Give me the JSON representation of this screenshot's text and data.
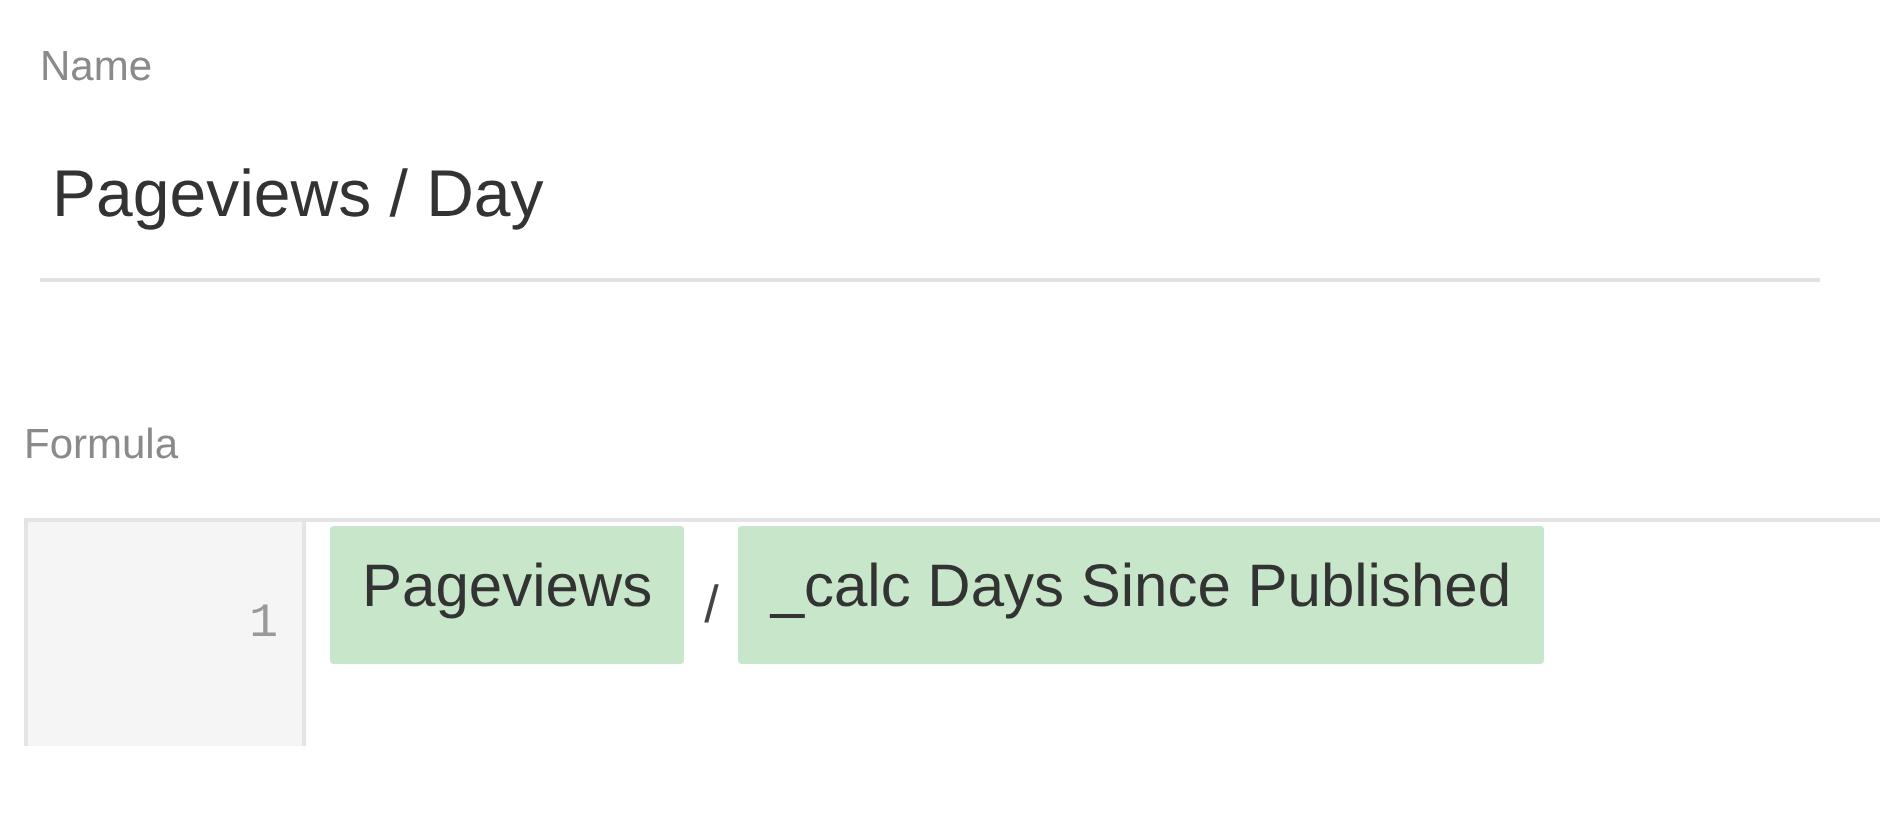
{
  "name_field": {
    "label": "Name",
    "value": "Pageviews / Day"
  },
  "formula": {
    "label": "Formula",
    "lines": [
      {
        "number": "1",
        "tokens": [
          {
            "kind": "field",
            "text": "Pageviews"
          },
          {
            "kind": "operator",
            "text": "/"
          },
          {
            "kind": "field",
            "text": "_calc Days Since Published"
          }
        ]
      }
    ]
  }
}
